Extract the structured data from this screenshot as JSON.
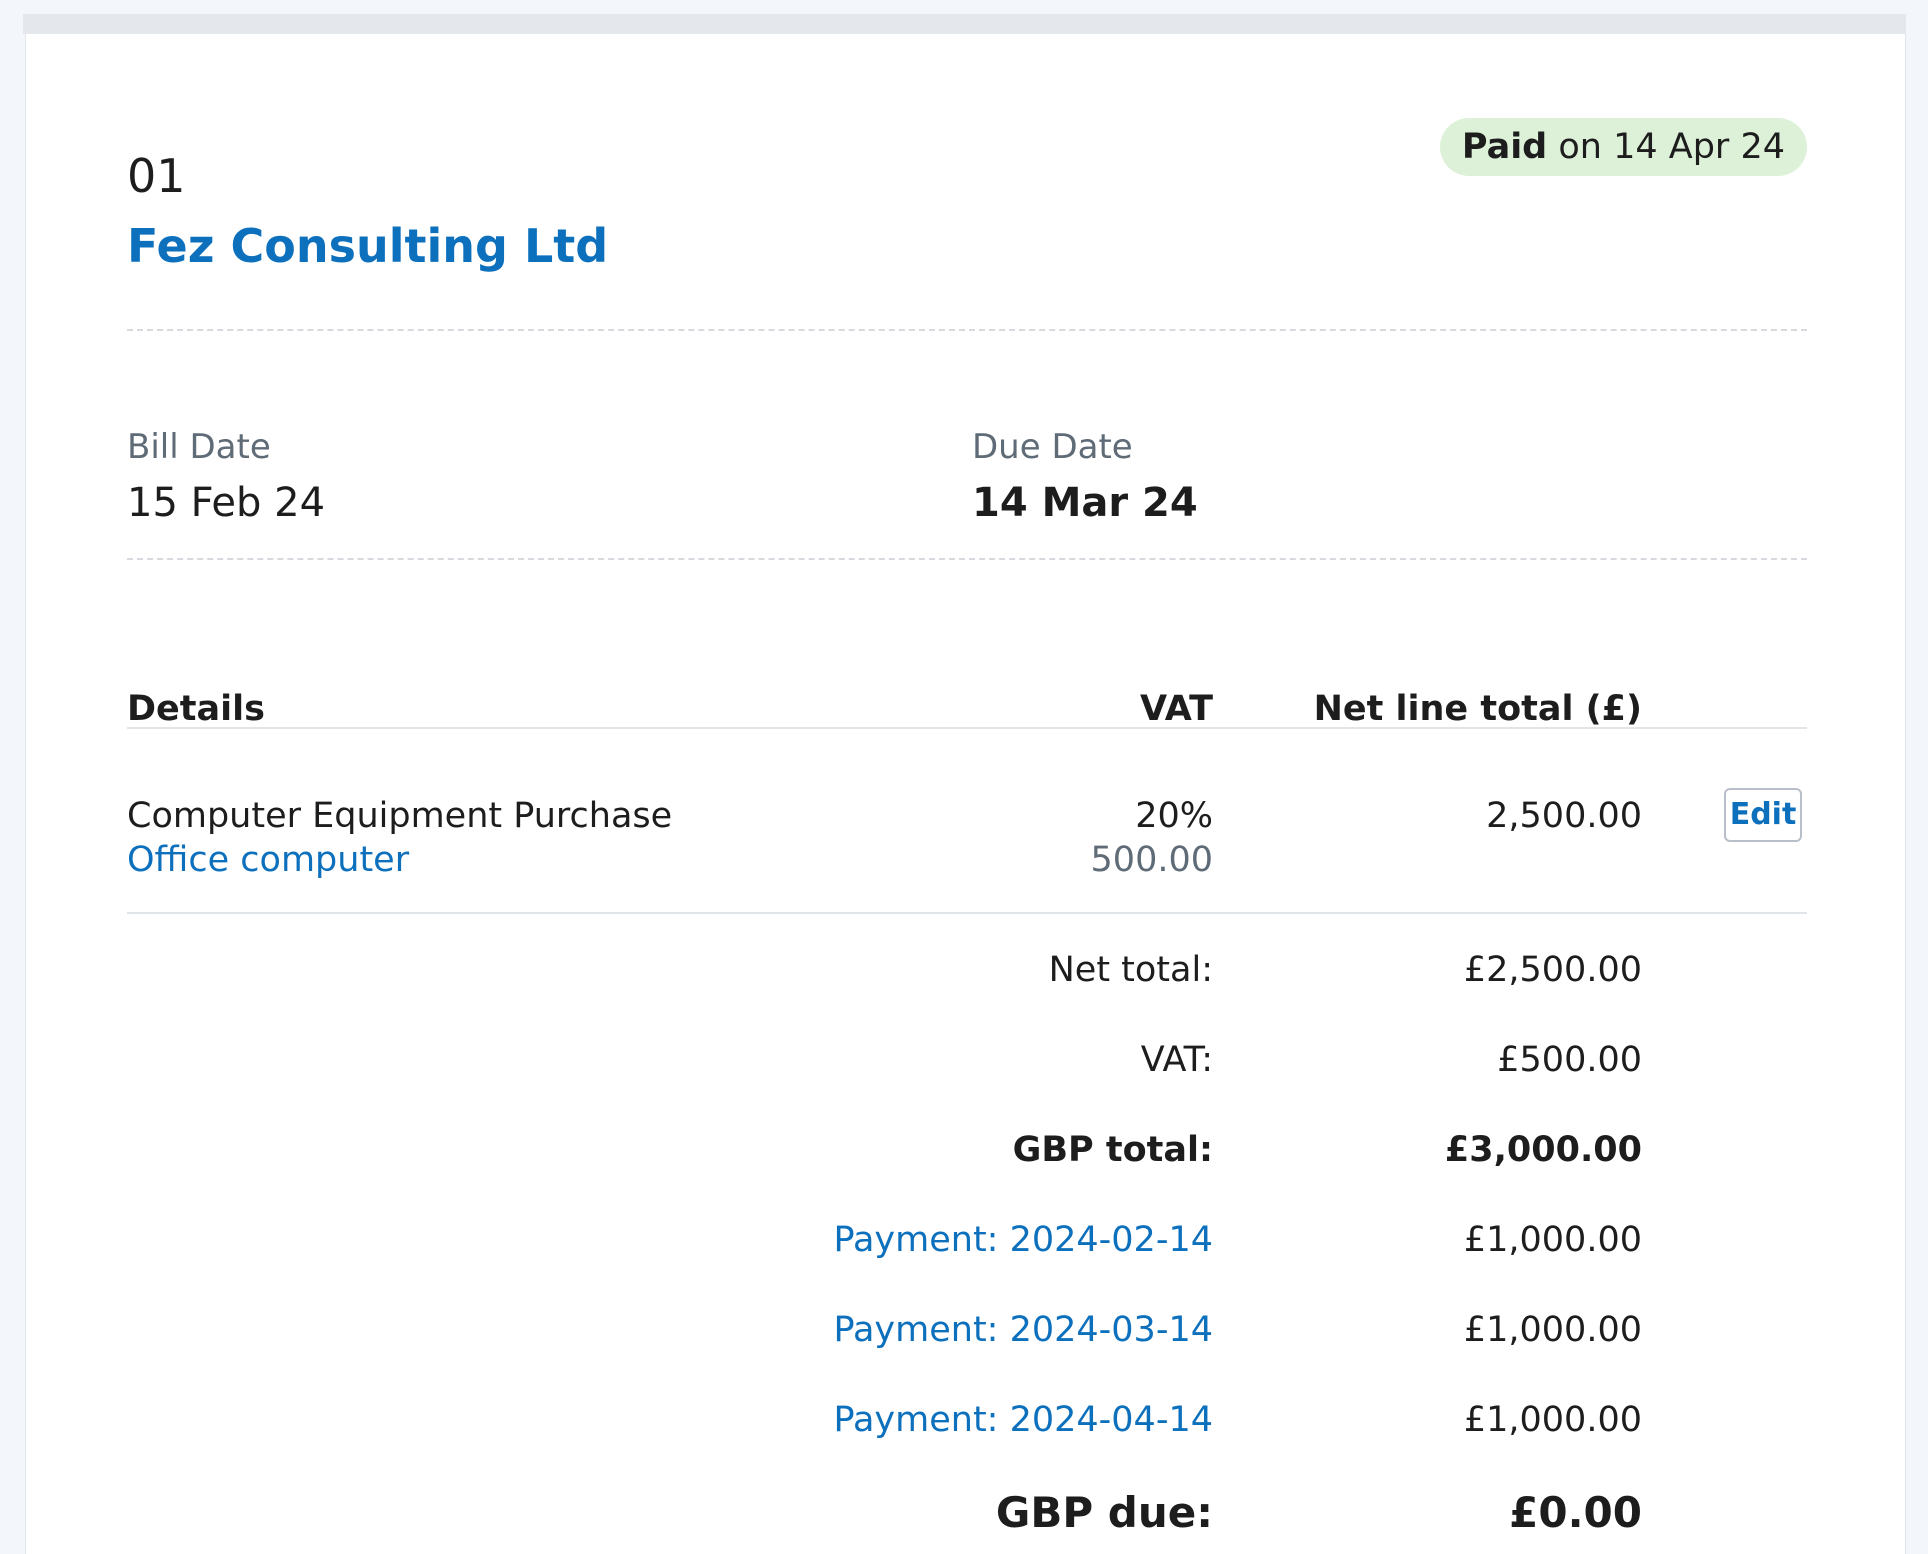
{
  "bill": {
    "number": "01",
    "status": {
      "prefix": "Paid",
      "suffix": "on 14 Apr 24"
    },
    "supplier": "Fez Consulting Ltd",
    "bill_date_label": "Bill Date",
    "bill_date": "15 Feb 24",
    "due_date_label": "Due Date",
    "due_date": "14 Mar 24"
  },
  "table": {
    "headers": {
      "details": "Details",
      "vat": "VAT",
      "net": "Net line total (£)"
    },
    "rows": [
      {
        "description": "Computer Equipment Purchase",
        "category": "Office computer",
        "vat_rate": "20%",
        "vat_amount": "500.00",
        "net_total": "2,500.00",
        "edit_label": "Edit"
      }
    ]
  },
  "totals": {
    "net_label": "Net total:",
    "net_value": "£2,500.00",
    "vat_label": "VAT:",
    "vat_value": "£500.00",
    "gbp_total_label": "GBP total:",
    "gbp_total_value": "£3,000.00",
    "payments": [
      {
        "label": "Payment: 2024-02-14",
        "amount": "£1,000.00"
      },
      {
        "label": "Payment: 2024-03-14",
        "amount": "£1,000.00"
      },
      {
        "label": "Payment: 2024-04-14",
        "amount": "£1,000.00"
      }
    ],
    "gbp_due_label": "GBP due:",
    "gbp_due_value": "£0.00"
  },
  "colors": {
    "link": "#0c70bd",
    "paid_badge_bg": "#ddf1d9",
    "muted_text": "#5f6b77"
  }
}
